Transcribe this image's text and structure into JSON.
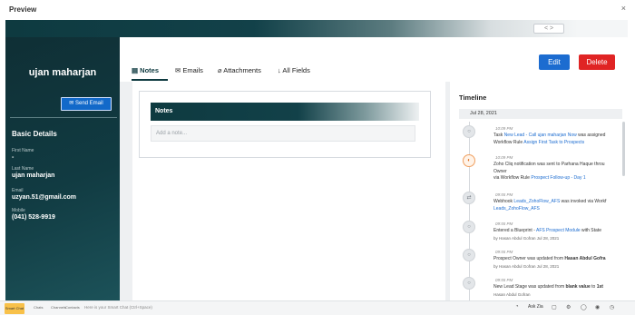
{
  "window": {
    "title": "Preview",
    "close_icon": "×",
    "pager": "< >"
  },
  "record": {
    "name": "ujan maharjan",
    "send_email": "Send Email",
    "section_title": "Basic Details",
    "fields": [
      {
        "label": "First Name",
        "value": "-"
      },
      {
        "label": "Last Name",
        "value": "ujan maharjan"
      },
      {
        "label": "Email",
        "value": "uzyan.51@gmail.com"
      },
      {
        "label": "Mobile",
        "value": "(041) 528-9919"
      }
    ]
  },
  "tabs": [
    {
      "label": "Notes",
      "icon": "notes-icon"
    },
    {
      "label": "Emails",
      "icon": "envelope-icon"
    },
    {
      "label": "Attachments",
      "icon": "paperclip-icon"
    },
    {
      "label": "All Fields",
      "icon": "arrow-down-icon"
    }
  ],
  "actions": {
    "edit": "Edit",
    "delete": "Delete"
  },
  "notes": {
    "header": "Notes",
    "placeholder": "Add a note..."
  },
  "timeline": {
    "title": "Timeline",
    "date": "Jul 28, 2021",
    "items": [
      {
        "time": "10:09 PM",
        "l1a": "Task ",
        "l1b": "New Lead - Call ujan maharjan Now",
        "l1c": " was assigned",
        "l2a": "Workflow Rule ",
        "l2b": "Assign First Task to Prospects"
      },
      {
        "time": "10:09 PM",
        "l1": "Zoho Cliq notification was sent to Parhana Haque throu",
        "l2": "Owner",
        "l3a": "via Workflow Rule ",
        "l3b": "Prospect Follow-up - Day 1"
      },
      {
        "time": "09:55 PM",
        "l1a": "Webhook ",
        "l1b": "Leads_ZohoFlow_AFS",
        "l1c": " was invoked via Workf",
        "l2": "Leads_ZohoFlow_AFS"
      },
      {
        "time": "09:55 PM",
        "l1a": "Entered a Blueprint - ",
        "l1b": "AFS Prospect Module",
        "l1c": " with State",
        "l2": "by Hasan Abdul Gofran Jul 28, 2021"
      },
      {
        "time": "09:55 PM",
        "l1a": "Prospect Owner was updated from ",
        "l1b": "Hasan Abdul Gofra",
        "l2": "by Hasan Abdul Gofran Jul 28, 2021"
      },
      {
        "time": "09:55 PM",
        "l1a": "New Lead Stage was updated from ",
        "l1b": "blank value",
        "l1c": " to ",
        "l1d": "1st",
        "l2": "Hasan Abdul Gofran"
      }
    ]
  },
  "bottombar": {
    "items": [
      "Chats",
      "Channels",
      "Contacts"
    ],
    "logo": "Smart Chat",
    "chat_placeholder": "Here is your Smart Chat (Ctrl+Space)",
    "ask": "Ask Zia"
  }
}
